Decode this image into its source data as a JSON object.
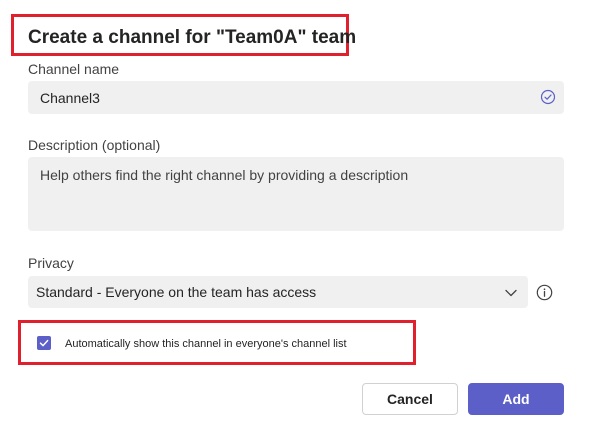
{
  "dialog": {
    "title": "Create a channel for \"Team0A\" team"
  },
  "channel_name": {
    "label": "Channel name",
    "value": "Channel3",
    "status_icon": "check-circle-icon"
  },
  "description": {
    "label": "Description (optional)",
    "placeholder": "Help others find the right channel by providing a description",
    "value": ""
  },
  "privacy": {
    "label": "Privacy",
    "selected": "Standard - Everyone on the team has access",
    "dropdown_icon": "chevron-down-icon",
    "info_icon": "info-icon"
  },
  "auto_show": {
    "label": "Automatically show this channel in everyone's channel list",
    "checked": true
  },
  "actions": {
    "cancel_label": "Cancel",
    "add_label": "Add"
  },
  "colors": {
    "accent": "#5b5fc7",
    "highlight": "#e0202c",
    "field_bg": "#f0f0f0"
  }
}
